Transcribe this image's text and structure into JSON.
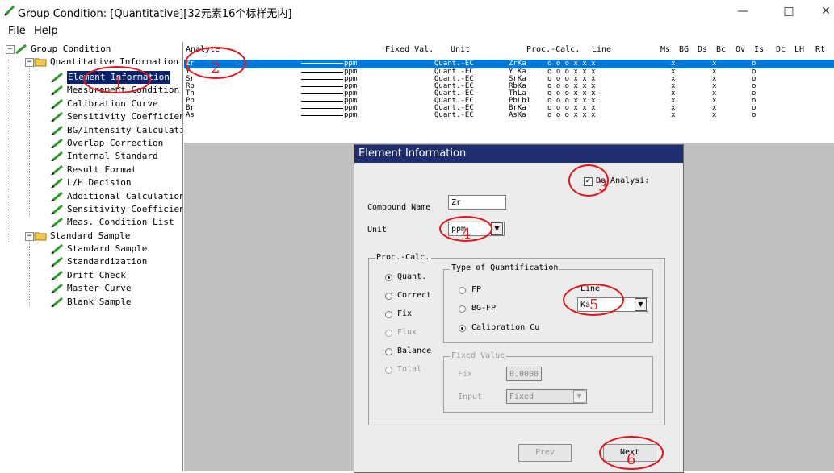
{
  "window": {
    "title": "Group Condition: [Quantitative][32元素16个标样无内]",
    "minimize": "—",
    "maximize": "□",
    "close": "✕",
    "icon": "pen-icon"
  },
  "menu": [
    "File",
    "Help"
  ],
  "tree": {
    "root": "Group Condition",
    "quant_folder": "Quantitative Information",
    "quant_items": [
      "Element Information",
      "Measurement Condition",
      "Calibration Curve",
      "Sensitivity Coefficien",
      "BG/Intensity Calculati",
      "Overlap Correction",
      "Internal Standard",
      "Result Format",
      "L/H Decision",
      "Additional Calculation",
      "Sensitivity Coefficien",
      "Meas. Condition List"
    ],
    "std_folder": "Standard Sample",
    "std_items": [
      "Standard Sample",
      "Standardization",
      "Drift Check",
      "Master Curve",
      "Blank Sample"
    ],
    "expander_minus": "−"
  },
  "list": {
    "headers": {
      "analyte": "Analyte",
      "fixed_val": "Fixed Val.",
      "unit": "Unit",
      "proc_calc": "Proc.-Calc.",
      "line": "Line",
      "ms": "Ms",
      "bg": "BG",
      "ds": "Ds",
      "bc": "Bc",
      "ov": "Ov",
      "is": "Is",
      "dc": "Dc",
      "lh": "LH",
      "rt": "Rt"
    },
    "rows": [
      {
        "analyte": "Zr",
        "unit": "ppm",
        "proc": "Quant.-EC",
        "line": "ZrKa",
        "flags": "o  o  o  x  x  x",
        "ms": "x",
        "ds": "x",
        "ov": "o"
      },
      {
        "analyte": "Y",
        "unit": "ppm",
        "proc": "Quant.-EC",
        "line": "Y Ka",
        "flags": "o  o  o  x  x  x",
        "ms": "x",
        "ds": "x",
        "ov": "o"
      },
      {
        "analyte": "Sr",
        "unit": "ppm",
        "proc": "Quant.-EC",
        "line": "SrKa",
        "flags": "o  o  o  x  x  x",
        "ms": "x",
        "ds": "x",
        "ov": "o"
      },
      {
        "analyte": "Rb",
        "unit": "ppm",
        "proc": "Quant.-EC",
        "line": "RbKa",
        "flags": "o  o  o  x  x  x",
        "ms": "x",
        "ds": "x",
        "ov": "o"
      },
      {
        "analyte": "Th",
        "unit": "ppm",
        "proc": "Quant.-EC",
        "line": "ThLa",
        "flags": "o  o  o  x  x  x",
        "ms": "x",
        "ds": "x",
        "ov": "o"
      },
      {
        "analyte": "Pb",
        "unit": "ppm",
        "proc": "Quant.-EC",
        "line": "PbLb1",
        "flags": "o  o  o  x  x  x",
        "ms": "x",
        "ds": "x",
        "ov": "o"
      },
      {
        "analyte": "Br",
        "unit": "ppm",
        "proc": "Quant.-EC",
        "line": "BrKa",
        "flags": "o  o  o  x  x  x",
        "ms": "x",
        "ds": "x",
        "ov": "o"
      },
      {
        "analyte": "As",
        "unit": "ppm",
        "proc": "Quant.-EC",
        "line": "AsKa",
        "flags": "o  o  o  x  x  x",
        "ms": "x",
        "ds": "x",
        "ov": "o"
      }
    ]
  },
  "dialog": {
    "title": "Element Information",
    "do_analysis_label": "Do Analysi:",
    "do_analysis_check": "✓",
    "compound_name_label": "Compound Name",
    "compound_name_value": "Zr",
    "unit_label": "Unit",
    "unit_value": "ppm",
    "dropdown_arrow": "▼",
    "proc_calc_title": "Proc.-Calc.",
    "proc_options": [
      "Quant.",
      "Correct",
      "Fix",
      "Flux",
      "Balance",
      "Total"
    ],
    "type_quant_title": "Type of Quantification",
    "type_options": [
      "FP",
      "BG-FP",
      "Calibration Cu"
    ],
    "line_label": "Line",
    "line_value": "Ka",
    "fixed_value_title": "Fixed Value",
    "fix_label": "Fix",
    "fix_value": "0.0000",
    "input_label": "Input",
    "input_value": "Fixed",
    "prev_button": "Prev",
    "next_button": "Next"
  },
  "annotations": [
    "1",
    "2",
    "3",
    "4",
    "5",
    "6"
  ],
  "colors": {
    "annotation": "#e4141b",
    "selection": "#0078d7",
    "dialog_title": "#1e2e6e"
  }
}
